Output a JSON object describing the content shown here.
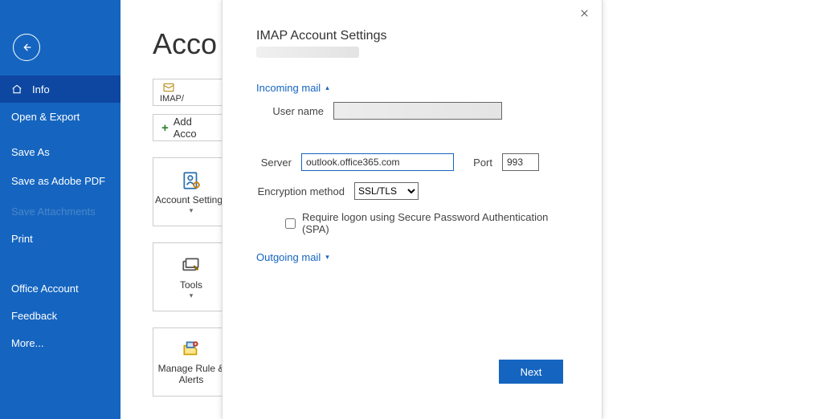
{
  "titlebar": {
    "smile": "☺",
    "frown": "☹",
    "help": "?",
    "minimize": "—",
    "maximize": "□",
    "close": "✕"
  },
  "sidebar": {
    "info": "Info",
    "open_export": "Open & Export",
    "save_as": "Save As",
    "save_adobe": "Save as Adobe PDF",
    "save_attachments": "Save Attachments",
    "print": "Print",
    "office_account": "Office Account",
    "feedback": "Feedback",
    "more": "More..."
  },
  "main": {
    "heading": "Acco",
    "acct_type": "IMAP/",
    "add_account": "Add Acco",
    "tiles": {
      "account_settings": "Account Settings",
      "tools": "Tools",
      "manage_rules": "Manage Rule & Alerts"
    }
  },
  "dialog": {
    "title": "IMAP Account Settings",
    "incoming": "Incoming mail",
    "username_label": "User name",
    "username_value": "",
    "server_label": "Server",
    "server_value": "outlook.office365.com",
    "port_label": "Port",
    "port_value": "993",
    "encryption_label": "Encryption method",
    "encryption_value": "SSL/TLS",
    "spa_label": "Require logon using Secure Password Authentication (SPA)",
    "outgoing": "Outgoing mail",
    "next": "Next"
  }
}
